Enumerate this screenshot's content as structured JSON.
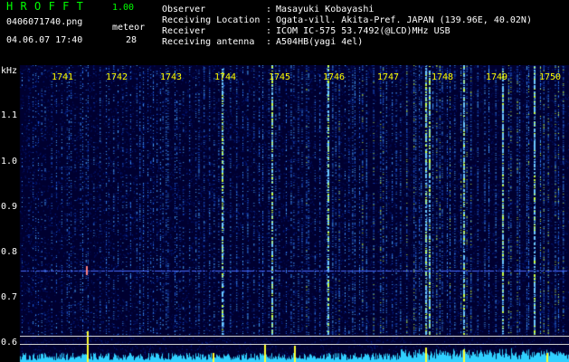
{
  "header": {
    "app_title": "HROFFT",
    "version": "1.00",
    "filename": "0406071740.png",
    "meteor_label": "meteor",
    "datetime": "04.06.07 17:40",
    "meteor_count": "28",
    "info": [
      {
        "label": "Observer",
        "value": "Masayuki Kobayashi"
      },
      {
        "label": "Receiving Location",
        "value": "Ogata-vill. Akita-Pref. JAPAN (139.96E, 40.02N)"
      },
      {
        "label": "Receiver",
        "value": "ICOM IC-575 53.7492(@LCD)MHz USB"
      },
      {
        "label": "Receiving antenna",
        "value": "A504HB(yagi 4el)"
      }
    ]
  },
  "spectrogram": {
    "y_unit": "kHz",
    "y_ticks": [
      "1.1",
      "1.0",
      "0.9",
      "0.8",
      "0.7",
      "0.6"
    ],
    "time_ticks": [
      "1741",
      "1742",
      "1743",
      "1744",
      "1745",
      "1746",
      "1747",
      "1748",
      "1749",
      "1750"
    ],
    "colors": {
      "background": "#000030",
      "trace": "#4aa8ff",
      "hot": "#c8ff40",
      "axis_label": "#ffff00",
      "power": "#30d0ff"
    }
  }
}
